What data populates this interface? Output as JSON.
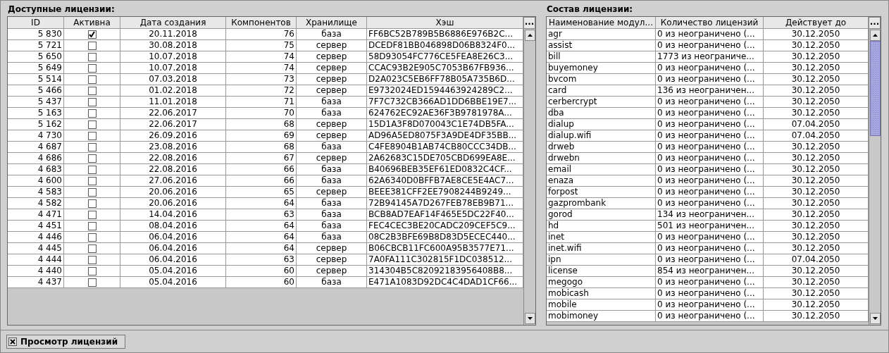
{
  "left_panel": {
    "title": "Доступные лицензии:",
    "columns": [
      "ID",
      "Активна",
      "Дата создания",
      "Компонентов",
      "Хранилище",
      "Хэш"
    ],
    "column_menu": "...",
    "rows": [
      {
        "id": "5 830",
        "active": true,
        "created": "20.11.2018",
        "components": "76",
        "storage": "база",
        "hash": "FF6BC52B789B5B6886E976B2C..."
      },
      {
        "id": "5 721",
        "active": false,
        "created": "30.08.2018",
        "components": "75",
        "storage": "сервер",
        "hash": "DCEDF81BB046898D06B8324F0..."
      },
      {
        "id": "5 650",
        "active": false,
        "created": "10.07.2018",
        "components": "74",
        "storage": "сервер",
        "hash": "58D93054FC776CE5FEA8E26C3..."
      },
      {
        "id": "5 649",
        "active": false,
        "created": "10.07.2018",
        "components": "74",
        "storage": "сервер",
        "hash": "CCAC93B2E905C7053B67FB936..."
      },
      {
        "id": "5 514",
        "active": false,
        "created": "07.03.2018",
        "components": "73",
        "storage": "сервер",
        "hash": "D2A023C5EB6FF78B05A735B6D..."
      },
      {
        "id": "5 466",
        "active": false,
        "created": "01.02.2018",
        "components": "72",
        "storage": "сервер",
        "hash": "E9732024ED1594463924289C2..."
      },
      {
        "id": "5 437",
        "active": false,
        "created": "11.01.2018",
        "components": "71",
        "storage": "база",
        "hash": "7F7C732CB366AD1DD6BBE19E7..."
      },
      {
        "id": "5 163",
        "active": false,
        "created": "22.06.2017",
        "components": "70",
        "storage": "база",
        "hash": "624762EC92AE36F3B9781978A..."
      },
      {
        "id": "5 162",
        "active": false,
        "created": "22.06.2017",
        "components": "68",
        "storage": "сервер",
        "hash": "15D1A3F8D070043C1E74DB5FA..."
      },
      {
        "id": "4 730",
        "active": false,
        "created": "26.09.2016",
        "components": "69",
        "storage": "сервер",
        "hash": "AD96A5ED8075F3A9DE4DF35BB..."
      },
      {
        "id": "4 687",
        "active": false,
        "created": "23.08.2016",
        "components": "68",
        "storage": "база",
        "hash": "C4FE8904B1AB74CB80CCC34DB..."
      },
      {
        "id": "4 686",
        "active": false,
        "created": "22.08.2016",
        "components": "67",
        "storage": "сервер",
        "hash": "2A62683C15DE705CBD699EA8E..."
      },
      {
        "id": "4 683",
        "active": false,
        "created": "22.08.2016",
        "components": "66",
        "storage": "база",
        "hash": "B40696BEB35EF61ED0832C4CF..."
      },
      {
        "id": "4 600",
        "active": false,
        "created": "27.06.2016",
        "components": "66",
        "storage": "база",
        "hash": "62A6340D0BFFB7AE8CE5E4AC7..."
      },
      {
        "id": "4 583",
        "active": false,
        "created": "20.06.2016",
        "components": "65",
        "storage": "сервер",
        "hash": "BEEE381CFF2EE7908244B9249..."
      },
      {
        "id": "4 582",
        "active": false,
        "created": "20.06.2016",
        "components": "64",
        "storage": "база",
        "hash": "72B94145A7D267FEB78EB9B71..."
      },
      {
        "id": "4 471",
        "active": false,
        "created": "14.04.2016",
        "components": "63",
        "storage": "база",
        "hash": "BCB8AD7EAF14F465E5DC22F40..."
      },
      {
        "id": "4 451",
        "active": false,
        "created": "08.04.2016",
        "components": "64",
        "storage": "база",
        "hash": "FEC4CEC3BE20CADC209CEF5C9..."
      },
      {
        "id": "4 446",
        "active": false,
        "created": "06.04.2016",
        "components": "64",
        "storage": "база",
        "hash": "08C2B3BFE69B8D83D5ECEC440..."
      },
      {
        "id": "4 445",
        "active": false,
        "created": "06.04.2016",
        "components": "64",
        "storage": "сервер",
        "hash": "B06CBCB11FC600A95B3577E71..."
      },
      {
        "id": "4 444",
        "active": false,
        "created": "06.04.2016",
        "components": "63",
        "storage": "сервер",
        "hash": "7A0FA111C302815F1DC038512..."
      },
      {
        "id": "4 440",
        "active": false,
        "created": "05.04.2016",
        "components": "60",
        "storage": "сервер",
        "hash": "314304B5C82092183956408B8..."
      },
      {
        "id": "4 437",
        "active": false,
        "created": "05.04.2016",
        "components": "60",
        "storage": "база",
        "hash": "E471A1083D92DC4C4DAD1CF66..."
      }
    ]
  },
  "right_panel": {
    "title": "Состав лицензии:",
    "columns": [
      "Наименование модул...",
      "Количество лицензий",
      "Действует до"
    ],
    "column_menu": "...",
    "rows": [
      {
        "module": "agr",
        "count": "0 из неограничено (...",
        "valid_until": "30.12.2050"
      },
      {
        "module": "assist",
        "count": "0 из неограничено (...",
        "valid_until": "30.12.2050"
      },
      {
        "module": "bill",
        "count": "1773 из неограниче...",
        "valid_until": "30.12.2050"
      },
      {
        "module": "buyemoney",
        "count": "0 из неограничено (...",
        "valid_until": "30.12.2050"
      },
      {
        "module": "bvcom",
        "count": "0 из неограничено (...",
        "valid_until": "30.12.2050"
      },
      {
        "module": "card",
        "count": "136 из неограничен...",
        "valid_until": "30.12.2050"
      },
      {
        "module": "cerbercrypt",
        "count": "0 из неограничено (...",
        "valid_until": "30.12.2050"
      },
      {
        "module": "dba",
        "count": "0 из неограничено (...",
        "valid_until": "30.12.2050"
      },
      {
        "module": "dialup",
        "count": "0 из неограничено (...",
        "valid_until": "07.04.2050"
      },
      {
        "module": "dialup.wifi",
        "count": "0 из неограничено (...",
        "valid_until": "07.04.2050"
      },
      {
        "module": "drweb",
        "count": "0 из неограничено (...",
        "valid_until": "30.12.2050"
      },
      {
        "module": "drwebn",
        "count": "0 из неограничено (...",
        "valid_until": "30.12.2050"
      },
      {
        "module": "email",
        "count": "0 из неограничено (...",
        "valid_until": "30.12.2050"
      },
      {
        "module": "enaza",
        "count": "0 из неограничено (...",
        "valid_until": "30.12.2050"
      },
      {
        "module": "forpost",
        "count": "0 из неограничено (...",
        "valid_until": "30.12.2050"
      },
      {
        "module": "gazprombank",
        "count": "0 из неограничено (...",
        "valid_until": "30.12.2050"
      },
      {
        "module": "gorod",
        "count": "134 из неограничен...",
        "valid_until": "30.12.2050"
      },
      {
        "module": "hd",
        "count": "501 из неограничен...",
        "valid_until": "30.12.2050"
      },
      {
        "module": "inet",
        "count": "0 из неограничено (...",
        "valid_until": "30.12.2050"
      },
      {
        "module": "inet.wifi",
        "count": "0 из неограничено (...",
        "valid_until": "30.12.2050"
      },
      {
        "module": "ipn",
        "count": "0 из неограничено (...",
        "valid_until": "07.04.2050"
      },
      {
        "module": "license",
        "count": "854 из неограничен...",
        "valid_until": "30.12.2050"
      },
      {
        "module": "megogo",
        "count": "0 из неограничено (...",
        "valid_until": "30.12.2050"
      },
      {
        "module": "mobicash",
        "count": "0 из неограничено (...",
        "valid_until": "30.12.2050"
      },
      {
        "module": "mobile",
        "count": "0 из неограничено (...",
        "valid_until": "30.12.2050"
      },
      {
        "module": "mobimoney",
        "count": "0 из неограничено (...",
        "valid_until": "30.12.2050"
      }
    ]
  },
  "tabs": [
    {
      "label": "Просмотр лицензий",
      "selected": true
    }
  ]
}
